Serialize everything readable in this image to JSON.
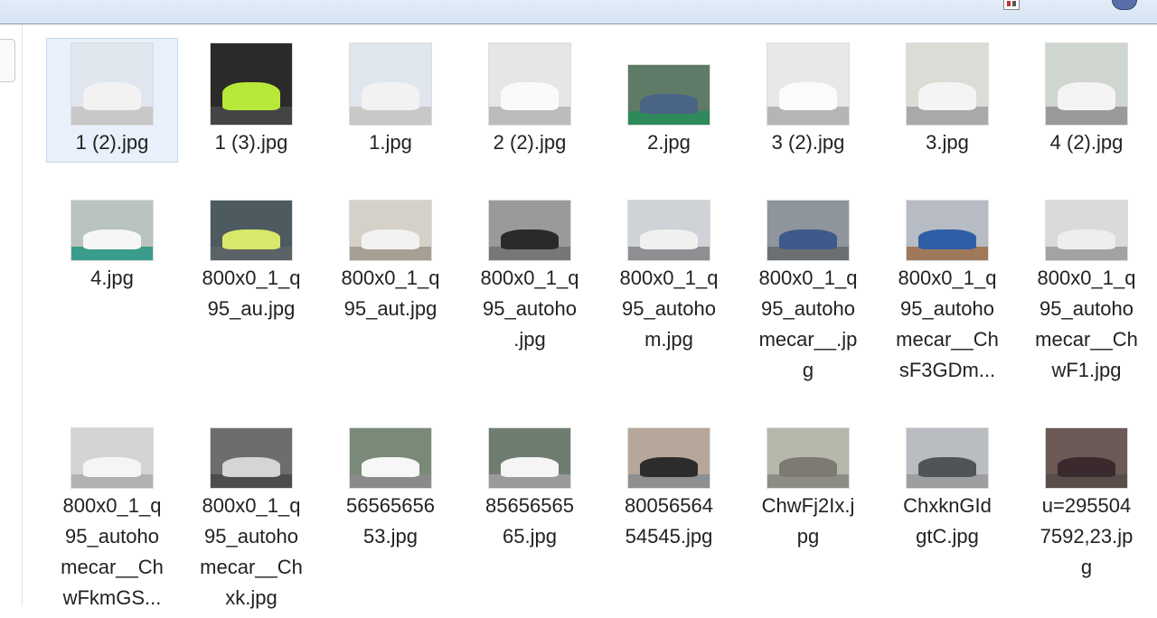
{
  "files": [
    {
      "name": "1 (2).jpg",
      "lines": [
        "1 (2).jpg"
      ],
      "bg": "#dfe6ee",
      "car": "#f2f2f2",
      "ground": "#c8c8c8",
      "shape": "sq",
      "selected": true
    },
    {
      "name": "1 (3).jpg",
      "lines": [
        "1 (3).jpg"
      ],
      "bg": "#2a2a2a",
      "car": "#b8e83a",
      "ground": "#444",
      "shape": "sq"
    },
    {
      "name": "1.jpg",
      "lines": [
        "1.jpg"
      ],
      "bg": "#dfe6ee",
      "car": "#f2f2f2",
      "ground": "#c8c8c8",
      "shape": "sq"
    },
    {
      "name": "2 (2).jpg",
      "lines": [
        "2 (2).jpg"
      ],
      "bg": "#e6e6e6",
      "car": "#fafafa",
      "ground": "#bcbcbc",
      "shape": "sq"
    },
    {
      "name": "2.jpg",
      "lines": [
        "2.jpg"
      ],
      "bg": "#5f7a66",
      "car": "#4a6485",
      "ground": "#2e8a5a",
      "shape": "ls"
    },
    {
      "name": "3 (2).jpg",
      "lines": [
        "3 (2).jpg"
      ],
      "bg": "#e8e8e8",
      "car": "#fbfbfb",
      "ground": "#b5b5b5",
      "shape": "sq"
    },
    {
      "name": "3.jpg",
      "lines": [
        "3.jpg"
      ],
      "bg": "#d9ddd6",
      "car": "#f4f4f4",
      "ground": "#a9a9a9",
      "shape": "sq"
    },
    {
      "name": "4 (2).jpg",
      "lines": [
        "4 (2).jpg"
      ],
      "bg": "#cfd6cf",
      "car": "#f4f4f4",
      "ground": "#9a9a9a",
      "shape": "sq"
    },
    {
      "name": "4.jpg",
      "lines": [
        "4.jpg"
      ],
      "bg": "#b9c3c0",
      "car": "#f6f6f6",
      "ground": "#3a9c8a",
      "shape": "ls"
    },
    {
      "name": "800x0_1_q95_au.jpg",
      "lines": [
        "800x0_1_q",
        "95_au.jpg"
      ],
      "bg": "#4d5a5f",
      "car": "#d8e86a",
      "ground": "#5c6366",
      "shape": "ls"
    },
    {
      "name": "800x0_1_q95_aut.jpg",
      "lines": [
        "800x0_1_q",
        "95_aut.jpg"
      ],
      "bg": "#d6d1c8",
      "car": "#f2f2f2",
      "ground": "#a69f94",
      "shape": "ls"
    },
    {
      "name": "800x0_1_q95_autoho.jpg",
      "lines": [
        "800x0_1_q",
        "95_autoho",
        ".jpg"
      ],
      "bg": "#9a9a9a",
      "car": "#2a2a2a",
      "ground": "#777",
      "shape": "ls"
    },
    {
      "name": "800x0_1_q95_autohom.jpg",
      "lines": [
        "800x0_1_q",
        "95_autoho",
        "m.jpg"
      ],
      "bg": "#cfd2d6",
      "car": "#f0f0f0",
      "ground": "#8d8f92",
      "shape": "ls"
    },
    {
      "name": "800x0_1_q95_autohomecar__.jpg",
      "lines": [
        "800x0_1_q",
        "95_autoho",
        "mecar__.jp",
        "g"
      ],
      "bg": "#8e959c",
      "car": "#3d5a8a",
      "ground": "#6c6f72",
      "shape": "ls"
    },
    {
      "name": "800x0_1_q95_autohomecar__ChsF3GDm...",
      "lines": [
        "800x0_1_q",
        "95_autoho",
        "mecar__Ch",
        "sF3GDm..."
      ],
      "bg": "#b7bcc4",
      "car": "#2f5da6",
      "ground": "#a0785a",
      "shape": "ls"
    },
    {
      "name": "800x0_1_q95_autohomecar__ChwF1.jpg",
      "lines": [
        "800x0_1_q",
        "95_autoho",
        "mecar__Ch",
        "wF1.jpg"
      ],
      "bg": "#d9dbd8",
      "car": "#eeeeee",
      "ground": "#a3a3a3",
      "shape": "ls"
    },
    {
      "name": "800x0_1_q95_autohomecar__ChwFkmGS...",
      "lines": [
        "800x0_1_q",
        "95_autoho",
        "mecar__Ch",
        "wFkmGS..."
      ],
      "bg": "#d2d4d6",
      "car": "#f5f5f5",
      "ground": "#b1b1b1",
      "shape": "ls"
    },
    {
      "name": "800x0_1_q95_autohomecar__Chxk.jpg",
      "lines": [
        "800x0_1_q",
        "95_autoho",
        "mecar__Ch",
        "xk.jpg"
      ],
      "bg": "#6d6d6d",
      "car": "#d5d5d5",
      "ground": "#4c4c4c",
      "shape": "ls"
    },
    {
      "name": "5656565653.jpg",
      "lines": [
        "56565656",
        "53.jpg"
      ],
      "bg": "#7a8a78",
      "car": "#f7f7f7",
      "ground": "#8a8a8a",
      "shape": "ls"
    },
    {
      "name": "8565656565.jpg",
      "lines": [
        "85656565",
        "65.jpg"
      ],
      "bg": "#6f7d70",
      "car": "#f5f5f5",
      "ground": "#9a9a9a",
      "shape": "ls"
    },
    {
      "name": "8005656454545.jpg",
      "lines": [
        "80056564",
        "54545.jpg"
      ],
      "bg": "#b7a79a",
      "car": "#2c2c2c",
      "ground": "#8f8f8f",
      "shape": "ls"
    },
    {
      "name": "ChwFj2Ix.jpg",
      "lines": [
        "ChwFj2Ix.j",
        "pg"
      ],
      "bg": "#b6b8ac",
      "car": "#7c7a72",
      "ground": "#8d8d85",
      "shape": "ls"
    },
    {
      "name": "ChxknGIdgtC.jpg",
      "lines": [
        "ChxknGId",
        "gtC.jpg"
      ],
      "bg": "#b9bcc0",
      "car": "#505458",
      "ground": "#9c9ea0",
      "shape": "ls"
    },
    {
      "name": "u=2955047592,23.jpg",
      "lines": [
        "u=295504",
        "7592,23.jp",
        "g"
      ],
      "bg": "#6b5a55",
      "car": "#3a2a2e",
      "ground": "#5a4e4a",
      "shape": "ls"
    }
  ]
}
